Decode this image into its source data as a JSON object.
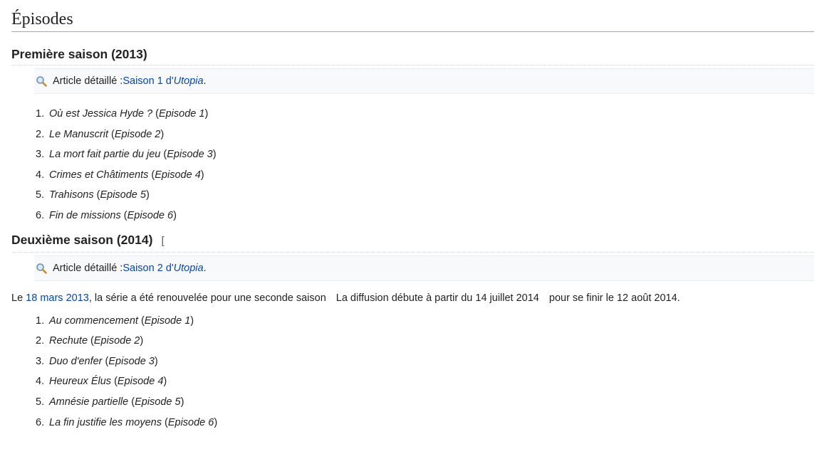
{
  "page": {
    "heading": "Épisodes"
  },
  "season1": {
    "title": "Première saison (2013)",
    "detail_label": "Article détaillé : ",
    "detail_link_prefix": "Saison 1 d'",
    "detail_link_italic": "Utopia",
    "detail_suffix": ".",
    "episodes": [
      {
        "num": "1.",
        "title": "Où est Jessica Hyde ?",
        "original": "Episode 1"
      },
      {
        "num": "2.",
        "title": "Le Manuscrit",
        "original": "Episode 2"
      },
      {
        "num": "3.",
        "title": "La mort fait partie du jeu",
        "original": "Episode 3"
      },
      {
        "num": "4.",
        "title": "Crimes et Châtiments",
        "original": "Episode 4"
      },
      {
        "num": "5.",
        "title": "Trahisons",
        "original": "Episode 5"
      },
      {
        "num": "6.",
        "title": "Fin de missions",
        "original": "Episode 6"
      }
    ]
  },
  "season2": {
    "title": "Deuxième saison (2014)",
    "edit_bracket": "[",
    "detail_label": "Article détaillé : ",
    "detail_link_prefix": "Saison 2 d'",
    "detail_link_italic": "Utopia",
    "detail_suffix": ".",
    "para_start": "Le ",
    "para_link": "18 mars 2013",
    "para_part1": ", la série a été renouvelée pour une seconde saison",
    "para_part2": "La diffusion débute à partir du 14 juillet 2014",
    "para_part3": "pour se finir le 12 août 2014.",
    "episodes": [
      {
        "num": "1.",
        "title": "Au commencement",
        "original": "Episode 1"
      },
      {
        "num": "2.",
        "title": "Rechute",
        "original": "Episode 2"
      },
      {
        "num": "3.",
        "title": "Duo d'enfer",
        "original": "Episode 3"
      },
      {
        "num": "4.",
        "title": "Heureux Élus",
        "original": "Episode 4"
      },
      {
        "num": "5.",
        "title": "Amnésie partielle",
        "original": "Episode 5"
      },
      {
        "num": "6.",
        "title": "La fin justifie les moyens",
        "original": "Episode 6"
      }
    ]
  },
  "icons": {
    "detail": "magnifier-icon"
  },
  "colors": {
    "link": "#0645ad",
    "text": "#222222",
    "box_bg": "#f8f9fa"
  }
}
